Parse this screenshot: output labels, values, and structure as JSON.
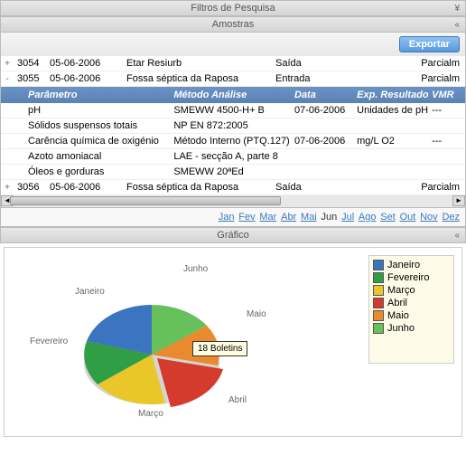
{
  "headers": {
    "filters": "Filtros de Pesquisa",
    "samples": "Amostras",
    "chart": "Gráfico"
  },
  "toolbar": {
    "export_label": "Exportar"
  },
  "grid": {
    "rows": [
      {
        "expander": "+",
        "code": "3054",
        "date": "05-06-2006",
        "desc": "Etar Resiurb",
        "dir": "Saída",
        "status": "Parcialm"
      },
      {
        "expander": "-",
        "code": "3055",
        "date": "05-06-2006",
        "desc": "Fossa séptica da Raposa",
        "dir": "Entrada",
        "status": "Parcialm"
      }
    ],
    "sub_header": {
      "name": "Parâmetro",
      "method": "Método Análise",
      "data": "Data",
      "exp": "Exp. Resultado",
      "vmr": "VMR"
    },
    "sub_rows": [
      {
        "name": "pH",
        "method": "SMEWW 4500-H+ B",
        "data": "07-06-2006",
        "exp": "Unidades de pH",
        "vmr": "---"
      },
      {
        "name": "Sólidos suspensos totais",
        "method": "NP EN 872:2005",
        "data": "",
        "exp": "",
        "vmr": ""
      },
      {
        "name": "Carência química de oxigénio",
        "method": "Método Interno (PTQ.127)",
        "data": "07-06-2006",
        "exp": "mg/L O2",
        "vmr": "---"
      },
      {
        "name": "Azoto amoniacal",
        "method": "LAE - secção A, parte 8",
        "data": "",
        "exp": "",
        "vmr": ""
      },
      {
        "name": "Óleos e gorduras",
        "method": "SMEWW 20ªEd",
        "data": "",
        "exp": "",
        "vmr": ""
      }
    ],
    "rows2": [
      {
        "expander": "+",
        "code": "3056",
        "date": "05-06-2006",
        "desc": "Fossa séptica da Raposa",
        "dir": "Saída",
        "status": "Parcialm"
      }
    ]
  },
  "pager": {
    "months": [
      "Jan",
      "Fev",
      "Mar",
      "Abr",
      "Mai",
      "Jun",
      "Jul",
      "Ago",
      "Set",
      "Out",
      "Nov",
      "Dez"
    ],
    "current": "Jun"
  },
  "chart_data": {
    "type": "pie",
    "title": "",
    "series": [
      {
        "name": "Janeiro",
        "value": 12,
        "color": "#3b74c0"
      },
      {
        "name": "Fevereiro",
        "value": 14,
        "color": "#2f9e44"
      },
      {
        "name": "Março",
        "value": 18,
        "color": "#e9c728"
      },
      {
        "name": "Abril",
        "value": 18,
        "color": "#d43b2d"
      },
      {
        "name": "Maio",
        "value": 10,
        "color": "#e88a2d"
      },
      {
        "name": "Junho",
        "value": 8,
        "color": "#66c15a"
      }
    ],
    "annotation": "18 Boletins",
    "labels": [
      "Janeiro",
      "Fevereiro",
      "Março",
      "Abril",
      "Maio",
      "Junho"
    ],
    "legend_position": "right"
  }
}
